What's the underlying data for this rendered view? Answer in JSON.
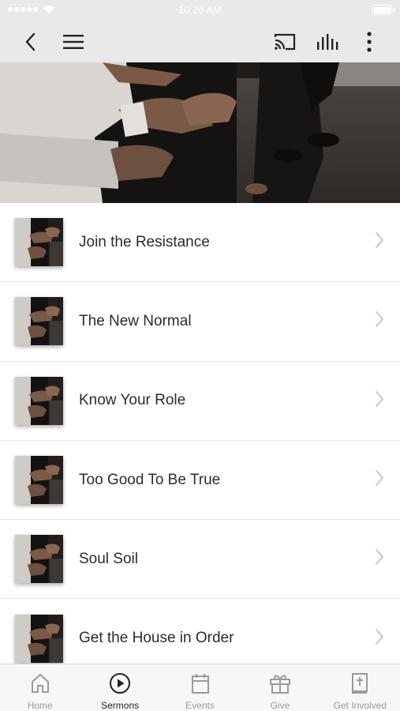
{
  "status_bar": {
    "time": "10:26 AM"
  },
  "nav": {
    "back_icon": "back-arrow-icon",
    "menu_icon": "hamburger-menu-icon",
    "cast_icon": "cast-icon",
    "audio_icon": "audio-levels-icon",
    "more_icon": "more-vertical-icon",
    "background": "#e9e9e9"
  },
  "hero": {
    "image": "worship-hands-photo"
  },
  "sermons": [
    {
      "title": "Join the Resistance"
    },
    {
      "title": "The New Normal"
    },
    {
      "title": "Know Your Role"
    },
    {
      "title": "Too Good To Be True"
    },
    {
      "title": "Soul Soil"
    },
    {
      "title": "Get the House in Order"
    }
  ],
  "tabs": [
    {
      "label": "Home",
      "icon": "home-icon",
      "active": false
    },
    {
      "label": "Sermons",
      "icon": "play-circle-icon",
      "active": true
    },
    {
      "label": "Events",
      "icon": "calendar-icon",
      "active": false
    },
    {
      "label": "Give",
      "icon": "gift-icon",
      "active": false
    },
    {
      "label": "Get Involved",
      "icon": "bible-icon",
      "active": false
    }
  ],
  "colors": {
    "text": "#2b2b2b",
    "tab_inactive": "#9a9a9a",
    "tab_active": "#222222",
    "divider": "#e6e6e6"
  }
}
